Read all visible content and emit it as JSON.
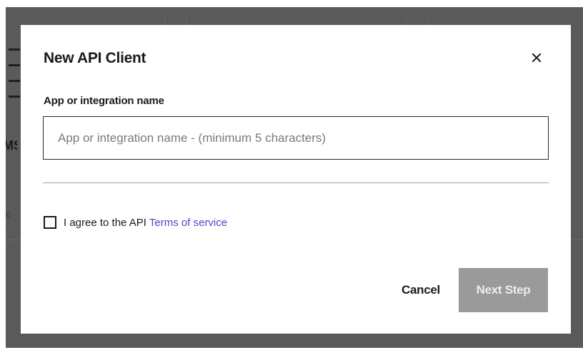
{
  "backdrop": {
    "partial_heading": "MS",
    "partial_link": "ore"
  },
  "dialog": {
    "title": "New API Client",
    "close_label": "Close",
    "field_label": "App or integration name",
    "name_input": {
      "value": "",
      "placeholder": "App or integration name - (minimum 5 characters)"
    },
    "agree": {
      "checked": false,
      "text": "I agree to the API",
      "link_text": "Terms of service"
    },
    "cancel_label": "Cancel",
    "next_label": "Next Step",
    "next_enabled": false
  },
  "colors": {
    "backdrop": "#5a5a5a",
    "link": "#5b3fc8",
    "disabled_button": "#9a9a9a"
  },
  "icons": {
    "close": "close-icon",
    "background_server": "server-rack-icon"
  }
}
